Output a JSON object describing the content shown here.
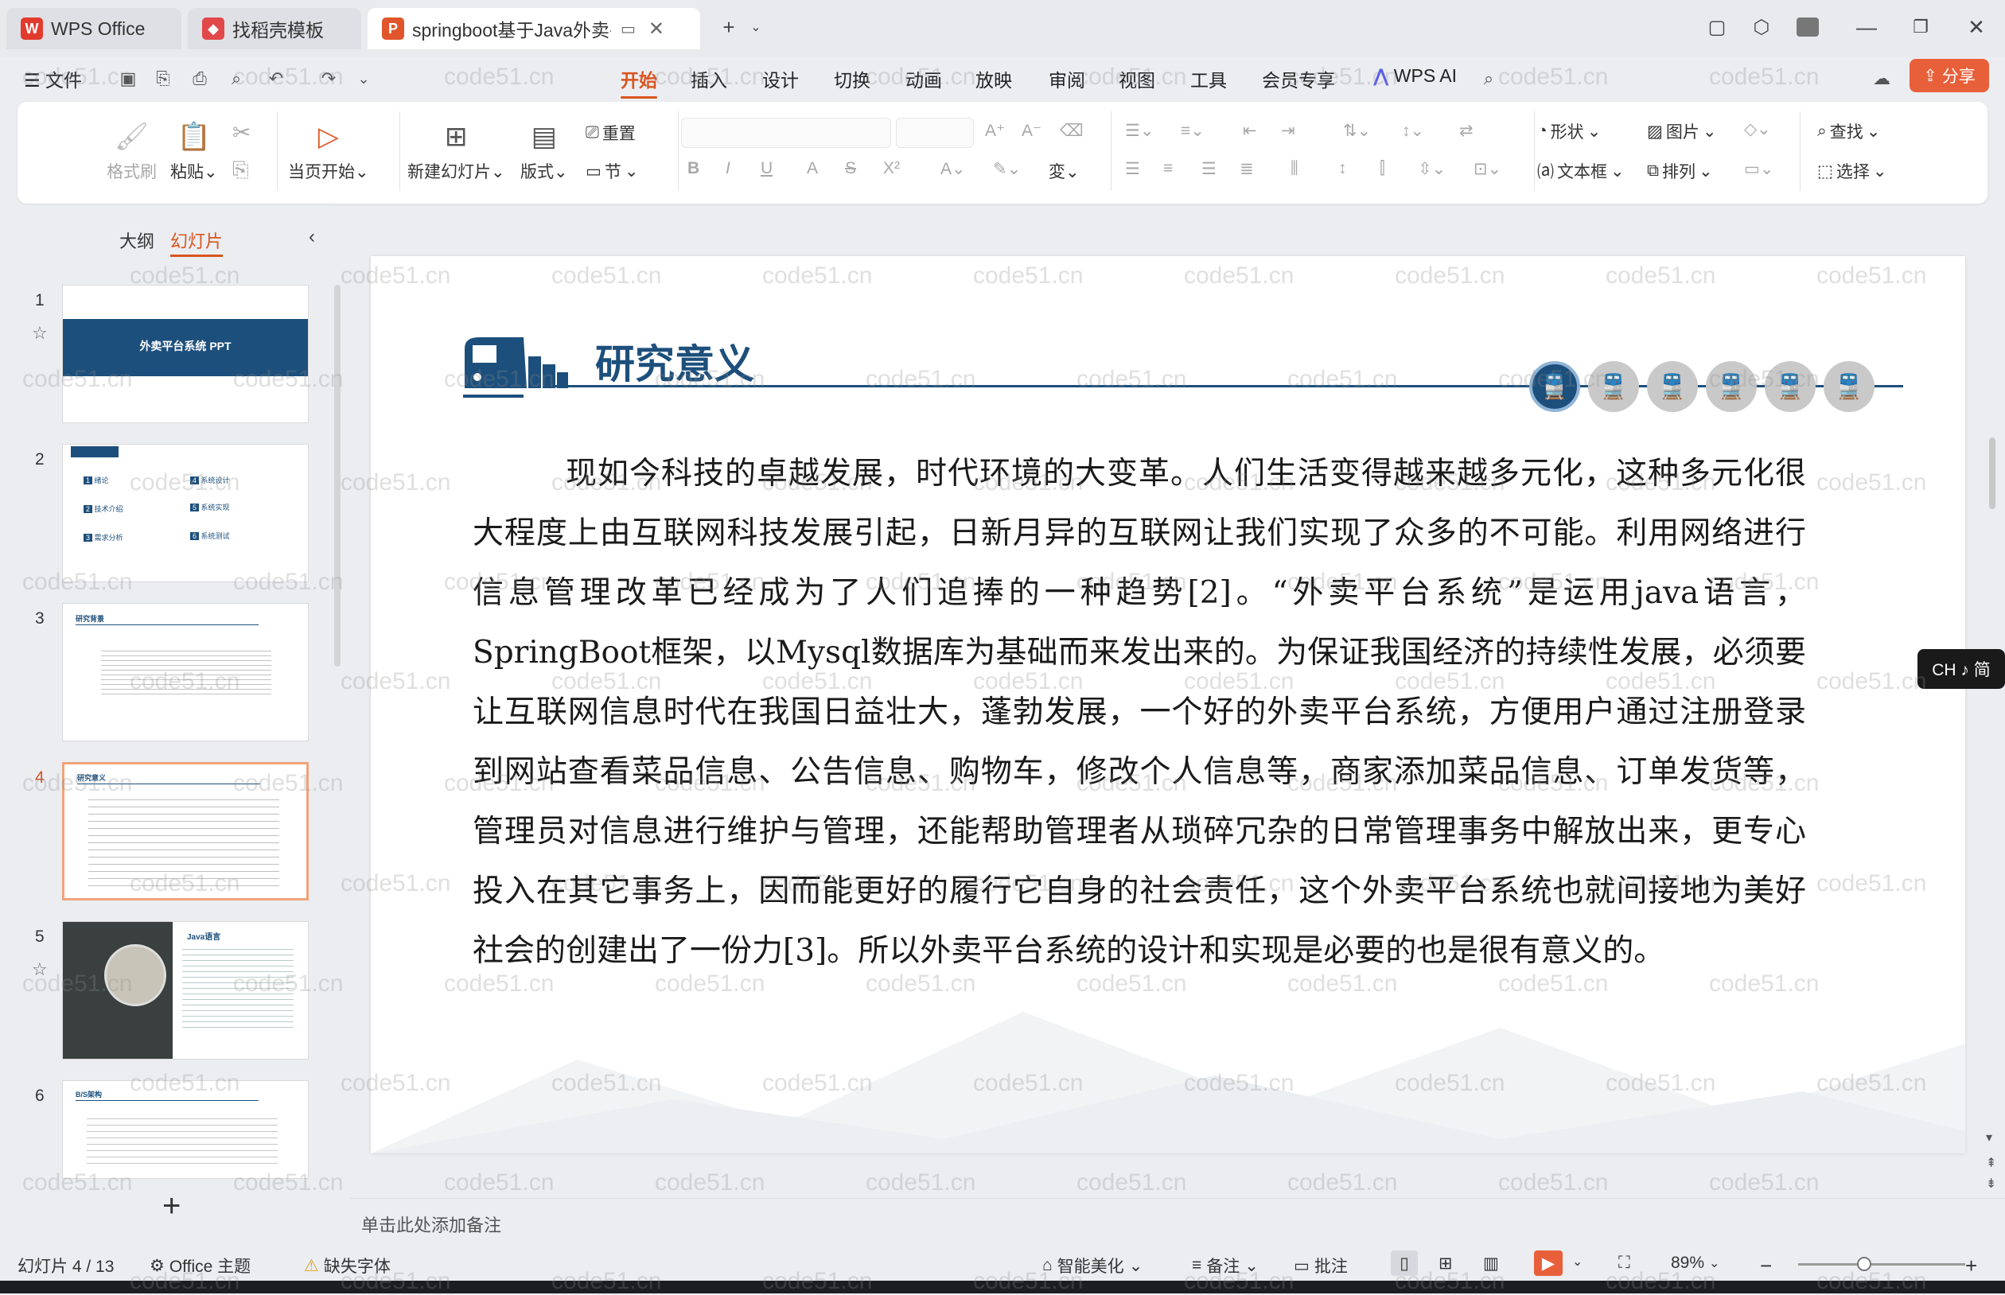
{
  "tabs": [
    {
      "label": "WPS Office",
      "icon": "wps-logo-icon"
    },
    {
      "label": "找稻壳模板",
      "icon": "docer-icon"
    },
    {
      "label": "springboot基于Java外卖平台",
      "icon": "ppt-icon"
    }
  ],
  "menu": {
    "file": "文件",
    "items": [
      "开始",
      "插入",
      "设计",
      "切换",
      "动画",
      "放映",
      "审阅",
      "视图",
      "工具",
      "会员专享"
    ],
    "ai": "WPS AI",
    "share": "分享"
  },
  "ribbon": {
    "format_painter": "格式刷",
    "paste": "粘贴",
    "start_from_current": "当页开始",
    "new_slide": "新建幻灯片",
    "layout": "版式",
    "reset": "重置",
    "section": "节",
    "shape": "形状",
    "picture": "图片",
    "find": "查找",
    "textbox": "文本框",
    "arrange": "排列",
    "select": "选择"
  },
  "left_panel": {
    "tab_outline": "大纲",
    "tab_slides": "幻灯片",
    "slide_numbers": [
      "1",
      "2",
      "3",
      "4",
      "5",
      "6"
    ],
    "thumb1_title": "外卖平台系统 PPT",
    "thumb2_items": [
      "绪论",
      "系统设计",
      "技术介绍",
      "系统实现",
      "需求分析",
      "系统测试"
    ],
    "thumb3_title": "研究背景",
    "thumb4_title": "研究意义",
    "thumb5_title": "Java语言",
    "thumb6_title": "B/S架构"
  },
  "slide": {
    "title": "研究意义",
    "body": "现如今科技的卓越发展，时代环境的大变革。人们生活变得越来越多元化，这种多元化很大程度上由互联网科技发展引起，日新月异的互联网让我们实现了众多的不可能。利用网络进行信息管理改革已经成为了人们追捧的一种趋势[2]。“外卖平台系统”是运用java语言，SpringBoot框架，以Mysql数据库为基础而来发出来的。为保证我国经济的持续性发展，必须要让互联网信息时代在我国日益壮大，蓬勃发展，一个好的外卖平台系统，方便用户通过注册登录到网站查看菜品信息、公告信息、购物车，修改个人信息等，商家添加菜品信息、订单发货等，管理员对信息进行维护与管理，还能帮助管理者从琐碎冗杂的日常管理事务中解放出来，更专心投入在其它事务上，因而能更好的履行它自身的社会责任，这个外卖平台系统也就间接地为美好社会的创建出了一份力[3]。所以外卖平台系统的设计和实现是必要的也是很有意义的。"
  },
  "notes_placeholder": "单击此处添加备注",
  "status": {
    "slide_counter": "幻灯片 4 / 13",
    "theme": "Office 主题",
    "missing_font": "缺失字体",
    "beautify": "智能美化",
    "notes": "备注",
    "comment": "批注",
    "zoom": "89%"
  },
  "ime": "CH ♪ 简",
  "watermark": "code51.cn",
  "colors": {
    "accent": "#d9541e",
    "slide_blue": "#1d4f7c",
    "share": "#e8603a"
  }
}
